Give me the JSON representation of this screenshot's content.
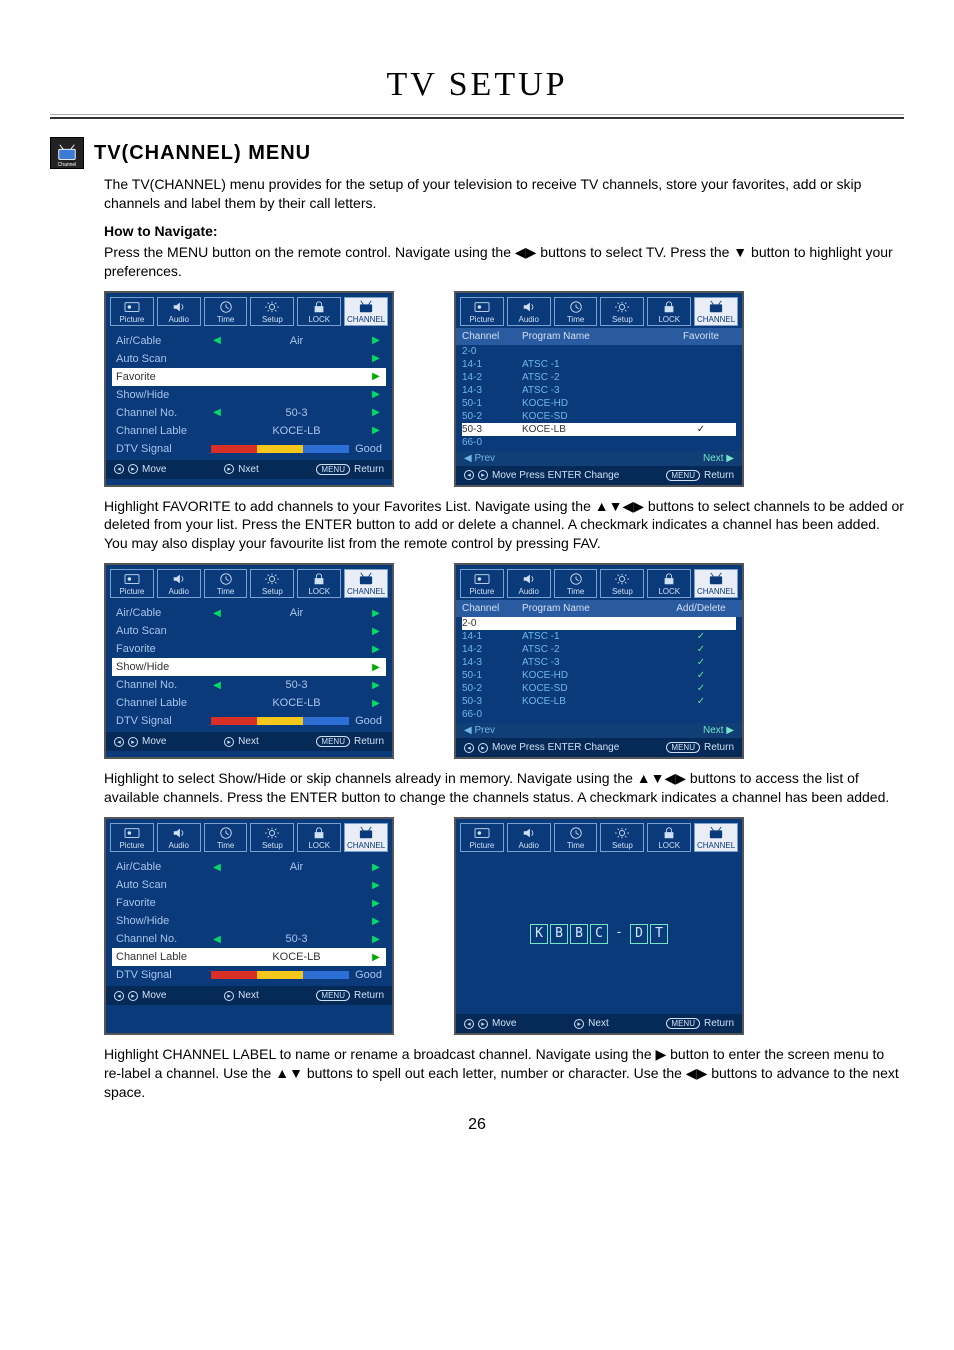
{
  "page": {
    "title": "TV SETUP",
    "section_heading": "TV(CHANNEL) MENU",
    "section_icon_label": "Channel",
    "intro": "The TV(CHANNEL) menu provides for the setup of your television to receive TV channels, store your favorites, add or skip channels and label them by their call letters.",
    "how_nav_heading": "How to Navigate:",
    "how_nav_body": "Press the MENU button on the remote control. Navigate using the ◀▶ buttons to select TV. Press the ▼ button to highlight your preferences.",
    "para_favorite": "Highlight FAVORITE to add channels to your Favorites List. Navigate using the ▲▼◀▶ buttons to select channels to be added or deleted from your list. Press the ENTER button to add or delete a channel. A checkmark indicates a channel has been added. You may also display your favourite list from the remote control by pressing FAV.",
    "para_showhide": "Highlight to select Show/Hide or skip channels already in memory. Navigate using the ▲▼◀▶ buttons to access the list of available channels. Press the ENTER button to change the channels status. A checkmark indicates a channel has been added.",
    "para_label": "Highlight CHANNEL LABEL to name or rename a broadcast channel. Navigate using the ▶ button to enter the screen menu to re-label a channel. Use the ▲▼ buttons to spell out each letter, number or character. Use the ◀▶ buttons to advance to the next space.",
    "page_number": "26"
  },
  "tabs": [
    "Picture",
    "Audio",
    "Time",
    "Setup",
    "LOCK",
    "CHANNEL"
  ],
  "menu_items": {
    "air_cable": {
      "label": "Air/Cable",
      "value": "Air"
    },
    "auto_scan": {
      "label": "Auto Scan"
    },
    "favorite": {
      "label": "Favorite"
    },
    "show_hide": {
      "label": "Show/Hide"
    },
    "channel_no": {
      "label": "Channel No.",
      "value": "50-3"
    },
    "channel_lbl": {
      "label": "Channel Lable",
      "value": "KOCE-LB"
    },
    "dtv_signal": {
      "label": "DTV Signal",
      "value": "Good"
    }
  },
  "footer": {
    "move": "Move",
    "next": "Next",
    "nxet": "Nxet",
    "return": "Return",
    "menu": "MENU",
    "list_center": "Move  Press ENTER Change"
  },
  "fav_list": {
    "hdr": {
      "c1": "Channel",
      "c2": "Program Name",
      "c3_fav": "Favorite",
      "c3_add": "Add/Delete"
    },
    "rows": [
      {
        "ch": "2-0",
        "name": ""
      },
      {
        "ch": "14-1",
        "name": "ATSC -1"
      },
      {
        "ch": "14-2",
        "name": "ATSC -2"
      },
      {
        "ch": "14-3",
        "name": "ATSC -3"
      },
      {
        "ch": "50-1",
        "name": "KOCE-HD"
      },
      {
        "ch": "50-2",
        "name": "KOCE-SD"
      },
      {
        "ch": "50-3",
        "name": "KOCE-LB"
      },
      {
        "ch": "66-0",
        "name": ""
      }
    ],
    "prev": "Prev",
    "next": "Next"
  },
  "label_editor": {
    "chars": [
      "K",
      "B",
      "B",
      "C",
      "-",
      "D",
      "T"
    ]
  }
}
